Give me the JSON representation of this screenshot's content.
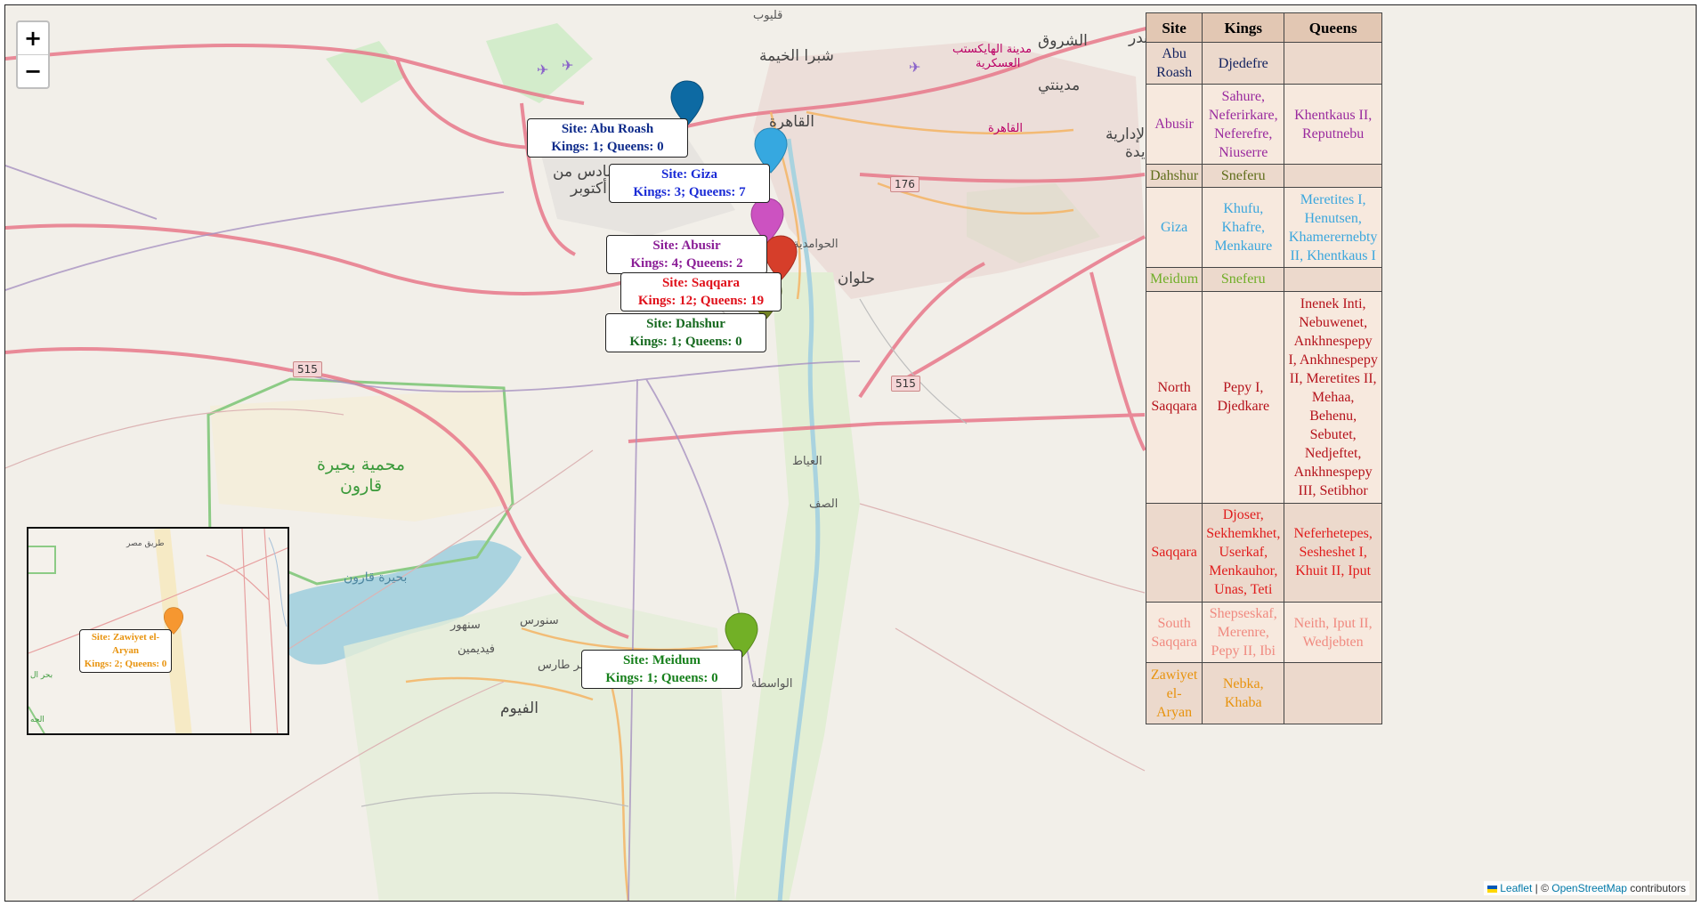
{
  "zoom": {
    "in_label": "+",
    "out_label": "−"
  },
  "map_labels": {
    "qalyub": "قليوب",
    "shubra": "شبرا الخيمة",
    "qahira_1": "القاهرة",
    "qahira_2": "القاهرة",
    "sixth_oct_1": "السادس من",
    "sixth_oct_2": "أكتوبر",
    "hawamdiya": "الحوامدية",
    "helwan": "حلوان",
    "shorouk": "الشروق",
    "badr": "بدر",
    "madinaty": "مدينتي",
    "military_city_1": "مدينة الهايكستب",
    "military_city_2": "العسكرية",
    "new_capital_1": "الإدارية",
    "new_capital_2": "جديدة",
    "ayat": "العياط",
    "saf": "الصف",
    "reserve_1": "محمية بحيرة",
    "reserve_2": "قارون",
    "lake": "بحيرة قارون",
    "sanhur": "سنهور",
    "sinnuris": "سنورس",
    "fidimin": "فيديمين",
    "tamiya": "مطر طارس",
    "fayoum": "الفيوم",
    "wasta": "الواسطة"
  },
  "shields": {
    "r176": "176",
    "r515a": "515",
    "r515b": "515"
  },
  "markers": [
    {
      "site": "Site: Abu Roash",
      "counts": "Kings: 1; Queens: 0",
      "color": "#0d6aa3",
      "text_color": "#0d2a8a"
    },
    {
      "site": "Site: Giza",
      "counts": "Kings: 3; Queens: 7",
      "color": "#36a8e0",
      "text_color": "#1a2bd6"
    },
    {
      "site": "Site: Abusir",
      "counts": "Kings: 4; Queens: 2",
      "color": "#cc52c1",
      "text_color": "#8a1d96"
    },
    {
      "site": "Site: Saqqara",
      "counts": "Kings: 12; Queens: 19",
      "color": "#d63e2a",
      "text_color": "#e0101a"
    },
    {
      "site": "Site: Dahshur",
      "counts": "Kings: 1; Queens: 0",
      "color": "#728224",
      "text_color": "#16691f"
    },
    {
      "site": "Site: Meidum",
      "counts": "Kings: 1; Queens: 0",
      "color": "#72b026",
      "text_color": "#17801c"
    },
    {
      "site": "Site: Zawiyet el-Aryan",
      "counts": "Kings: 2; Queens: 0",
      "color": "#f69730",
      "text_color": "#e8930e"
    }
  ],
  "inset_labels": {
    "road": "طريق مصر",
    "left_1": "بحر ال",
    "left_2": "الجه"
  },
  "table": {
    "headers": [
      "Site",
      "Kings",
      "Queens"
    ],
    "rows": [
      {
        "site": "Abu Roash",
        "kings": "Djedefre",
        "queens": "",
        "color": "#10205e"
      },
      {
        "site": "Abusir",
        "kings": "Sahure, Neferirkare, Neferefre, Niuserre",
        "queens": "Khentkaus II, Reputnebu",
        "color": "#9a2a9e"
      },
      {
        "site": "Dahshur",
        "kings": "Sneferu",
        "queens": "",
        "color": "#5f6d1a"
      },
      {
        "site": "Giza",
        "kings": "Khufu, Khafre, Menkaure",
        "queens": "Meretites I, Henutsen, Khamerernebty II, Khentkaus I",
        "color": "#3aa6dd"
      },
      {
        "site": "Meidum",
        "kings": "Sneferu",
        "queens": "",
        "color": "#6fae27"
      },
      {
        "site": "North Saqqara",
        "kings": "Pepy I, Djedkare",
        "queens": "Inenek Inti, Nebuwenet, Ankhnespepy I, Ankhnespepy II, Meretites II, Mehaa, Behenu, Sebutet, Nedjeftet, Ankhnespepy III, Setibhor",
        "color": "#b5121b"
      },
      {
        "site": "Saqqara",
        "kings": "Djoser, Sekhemkhet, Userkaf, Menkauhor, Unas, Teti",
        "queens": "Neferhetepes, Sesheshet I, Khuit II, Iput",
        "color": "#e01c1c"
      },
      {
        "site": "South Saqqara",
        "kings": "Shepseskaf, Merenre, Pepy II, Ibi",
        "queens": "Neith, Iput II, Wedjebten",
        "color": "#f08a80"
      },
      {
        "site": "Zawiyet el-Aryan",
        "kings": "Nebka, Khaba",
        "queens": "",
        "color": "#e8930e"
      }
    ]
  },
  "attribution": {
    "leaflet": "Leaflet",
    "sep": " | © ",
    "osm": "OpenStreetMap",
    "suffix": " contributors"
  }
}
